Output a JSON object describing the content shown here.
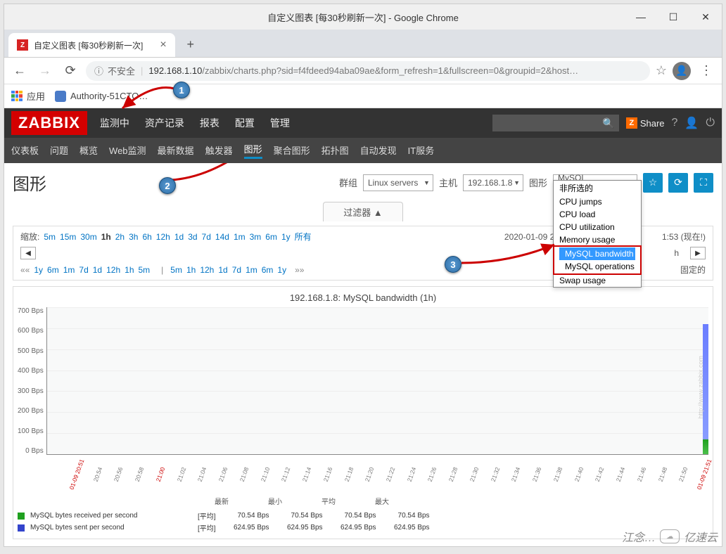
{
  "window": {
    "title": "自定义图表 [每30秒刷新一次] - Google Chrome",
    "buttons": {
      "min": "—",
      "max": "☐",
      "close": "✕"
    }
  },
  "tab": {
    "title": "自定义图表 [每30秒刷新一次]"
  },
  "address": {
    "insecure_icon": "ⓘ",
    "insecure_label": "不安全",
    "sep": "|",
    "host": "192.168.1.10",
    "path": "/zabbix/charts.php?sid=f4fdeed94aba09ae&form_refresh=1&fullscreen=0&groupid=2&host…",
    "star": "☆"
  },
  "bookmarks": {
    "apps": "应用",
    "link1": "Authority-51CTO…"
  },
  "callouts": {
    "c1": "1",
    "c2": "2",
    "c3": "3"
  },
  "zabbix": {
    "logo": "ZABBIX",
    "nav": [
      "监测中",
      "资产记录",
      "报表",
      "配置",
      "管理"
    ],
    "share": "Share",
    "subnav": [
      "仪表板",
      "问题",
      "概览",
      "Web监测",
      "最新数据",
      "触发器",
      "图形",
      "聚合图形",
      "拓扑图",
      "自动发现",
      "IT服务"
    ],
    "subnav_active_index": 6
  },
  "page": {
    "title": "图形",
    "group_label": "群组",
    "group_value": "Linux servers",
    "host_label": "主机",
    "host_value": "192.168.1.8",
    "graph_label": "图形",
    "graph_value": "MySQL bandwidth",
    "icons": {
      "fav": "☆",
      "refresh": "⟳",
      "full": "⛶"
    },
    "dropdown": [
      "非所选的",
      "CPU jumps",
      "CPU load",
      "CPU utilization",
      "Memory usage",
      "MySQL bandwidth",
      "MySQL operations",
      "Swap usage"
    ],
    "dropdown_hl": [
      5,
      6
    ],
    "filter_label": "过滤器 ▲",
    "zoom_label": "缩放:",
    "zoom_opts": [
      "5m",
      "15m",
      "30m",
      "1h",
      "2h",
      "3h",
      "6h",
      "12h",
      "1d",
      "3d",
      "7d",
      "14d",
      "1m",
      "3m",
      "6m",
      "1y",
      "所有"
    ],
    "zoom_current": "1h",
    "time_now": "2020-01-09 20:5",
    "time_now_suffix": "1:53 (现在!)",
    "nav_left_opts": [
      "1y",
      "6m",
      "1m",
      "7d",
      "1d",
      "12h",
      "1h",
      "5m"
    ],
    "nav_right_opts": [
      "5m",
      "1h",
      "12h",
      "1d",
      "7d",
      "1m",
      "6m",
      "1y"
    ],
    "nav_ll": "««",
    "nav_rr": "»»",
    "nav_pipe": "|",
    "nav_h": "h",
    "fixed_label": "固定的"
  },
  "chart_data": {
    "type": "line",
    "title": "192.168.1.8: MySQL bandwidth (1h)",
    "ylabel": "Bps",
    "ylim": [
      0,
      700
    ],
    "yticks": [
      "700 Bps",
      "600 Bps",
      "500 Bps",
      "400 Bps",
      "300 Bps",
      "200 Bps",
      "100 Bps",
      "0 Bps"
    ],
    "xticks": [
      "01-09 20:51",
      "20:54",
      "20:56",
      "20:58",
      "21:00",
      "21:02",
      "21:04",
      "21:06",
      "21:08",
      "21:10",
      "21:12",
      "21:14",
      "21:16",
      "21:18",
      "21:20",
      "21:22",
      "21:24",
      "21:26",
      "21:28",
      "21:30",
      "21:32",
      "21:34",
      "21:36",
      "21:38",
      "21:40",
      "21:42",
      "21:44",
      "21:46",
      "21:48",
      "21:50",
      "01-09 21:51"
    ],
    "xtick_red": [
      0,
      4,
      30
    ],
    "series": [
      {
        "name": "MySQL bytes received per second",
        "color": "#1fa01f",
        "agg": "[平均]",
        "latest": "70.54 Bps",
        "min": "70.54 Bps",
        "avg": "70.54 Bps",
        "max": "70.54 Bps",
        "value": 70.54
      },
      {
        "name": "MySQL bytes sent per second",
        "color": "#3344cc",
        "agg": "[平均]",
        "latest": "624.95 Bps",
        "min": "624.95 Bps",
        "avg": "624.95 Bps",
        "max": "624.95 Bps",
        "value": 624.95
      }
    ],
    "stat_headers": [
      "最新",
      "最小",
      "平均",
      "最大"
    ],
    "watermark": "http://www.zabbix.com"
  },
  "footer": {
    "text1": "江念…",
    "brand": "亿速云"
  }
}
